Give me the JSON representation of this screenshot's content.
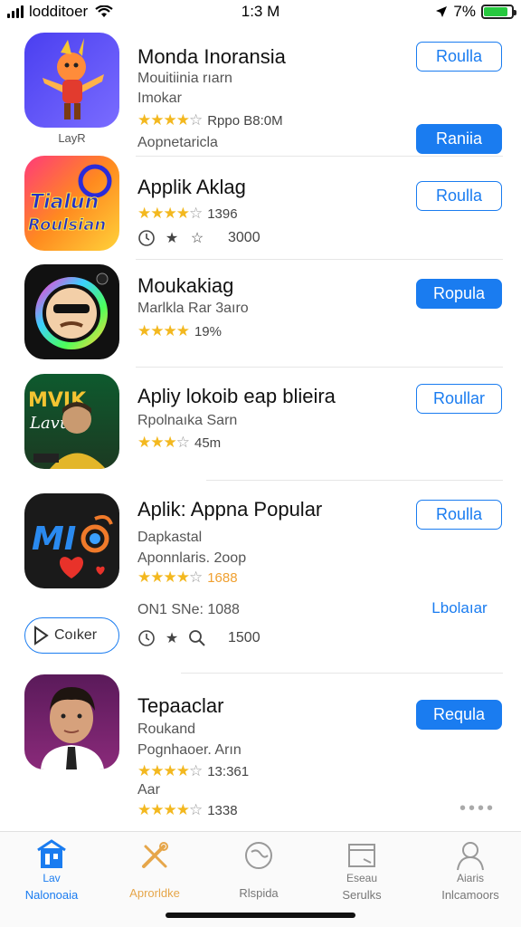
{
  "status_bar": {
    "carrier": "lodditoer",
    "time": "1:3 M",
    "battery": "7%"
  },
  "apps": [
    {
      "name": "Monda Inoransia",
      "sub1": "Mouitiinia rıarn",
      "sub2": "Imokar",
      "rating_stars": 4,
      "rating_text": "Rppo B8:0M",
      "extra": "Aopnetaricla",
      "icon_caption": "LayR",
      "button1": "Roulla",
      "button2": "Raniia"
    },
    {
      "name": "Applik Aklag",
      "rating_stars": 4,
      "rating_text": "1396",
      "mini_value": "3000",
      "button1": "Roulla",
      "icon_text": "Tialun Roulsian"
    },
    {
      "name": "Moukakiag",
      "sub1": "Marlkla Rar 3aıro",
      "rating_stars": 4,
      "rating_text": "19%",
      "button1": "Ropula"
    },
    {
      "name": "Apliy lokoib eap blieira",
      "sub1": "Rpolnaıka Sarn",
      "rating_stars": 3,
      "rating_text": "45m",
      "button1": "Roullar",
      "icon_text": "MVIK Lavu"
    },
    {
      "name": "Aplik: Appna Popular",
      "sub1": "Dapkastal",
      "sub2": "Aponnlaris. 2oop",
      "rating_stars": 4,
      "rating_text": "1688",
      "extra": "ON1 SNe: 1088",
      "mini_value": "1500",
      "button1": "Roulla",
      "button2": "Lbolaıar",
      "pill_label": "Coıker",
      "icon_text": "MI"
    },
    {
      "name": "Tepaaclar",
      "sub1": "Roukand",
      "sub2": "Pognhaoer. Arın",
      "rating_stars": 4,
      "rating_text": "13:361",
      "extra": "Aar",
      "rating2_stars": 4,
      "rating2_text": "1338",
      "button1": "Requla"
    }
  ],
  "tabs": [
    {
      "label": "Nalonoaia",
      "sub": "Lav",
      "icon": "home-icon",
      "active": true
    },
    {
      "label": "Aprorldke",
      "icon": "tools-icon"
    },
    {
      "label": "Rlspida",
      "icon": "globe-icon"
    },
    {
      "label": "Serulks",
      "sub": "Eseau",
      "icon": "folder-icon"
    },
    {
      "label": "Inlcamoors",
      "sub": "Aiaris",
      "icon": "person-icon"
    }
  ]
}
